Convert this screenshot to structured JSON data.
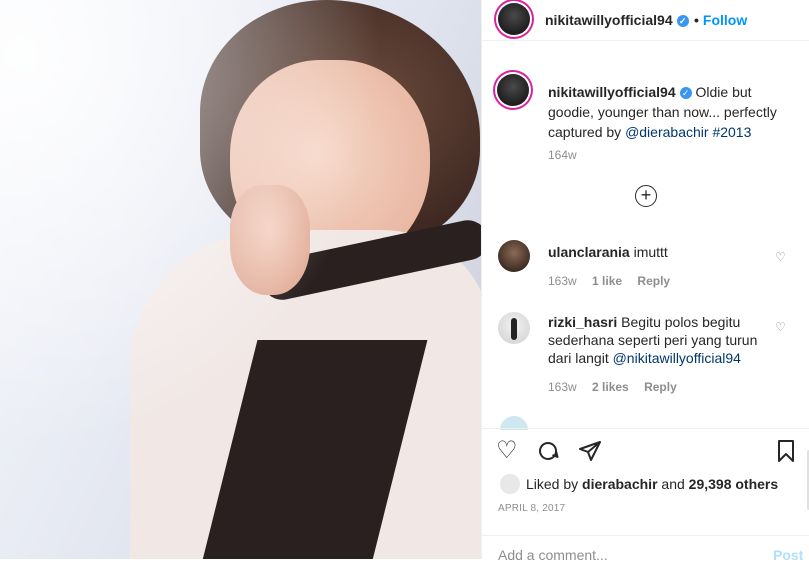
{
  "post": {
    "username": "nikitawillyofficial94",
    "follow_label": "Follow",
    "caption_text": "Oldie but goodie, younger than now... perfectly captured by",
    "caption_mention": "@dierabachir",
    "caption_hashtag": "#2013",
    "caption_time": "164w"
  },
  "comments": [
    {
      "user": "ulanclarania",
      "text": "imuttt",
      "time": "163w",
      "likes": "1 like",
      "reply": "Reply"
    },
    {
      "user": "rizki_hasri",
      "text": "Begitu polos begitu sederhana seperti peri yang turun dari langit",
      "mention": "@nikitawillyofficial94",
      "time": "163w",
      "likes": "2 likes",
      "reply": "Reply"
    }
  ],
  "footer": {
    "liked_by_prefix": "Liked by",
    "liked_by_user": "dierabachir",
    "liked_by_and": "and",
    "liked_by_count": "29,398 others",
    "date": "April 8, 2017",
    "comment_placeholder": "Add a comment...",
    "post_label": "Post"
  },
  "colors": {
    "accent": "#0095f6",
    "verified": "#3897f0",
    "muted": "#8e8e8e",
    "link": "#00376b"
  },
  "icons": [
    "verified-badge-icon",
    "load-more-comments-icon",
    "heart-icon",
    "comment-icon",
    "share-icon",
    "bookmark-icon"
  ]
}
